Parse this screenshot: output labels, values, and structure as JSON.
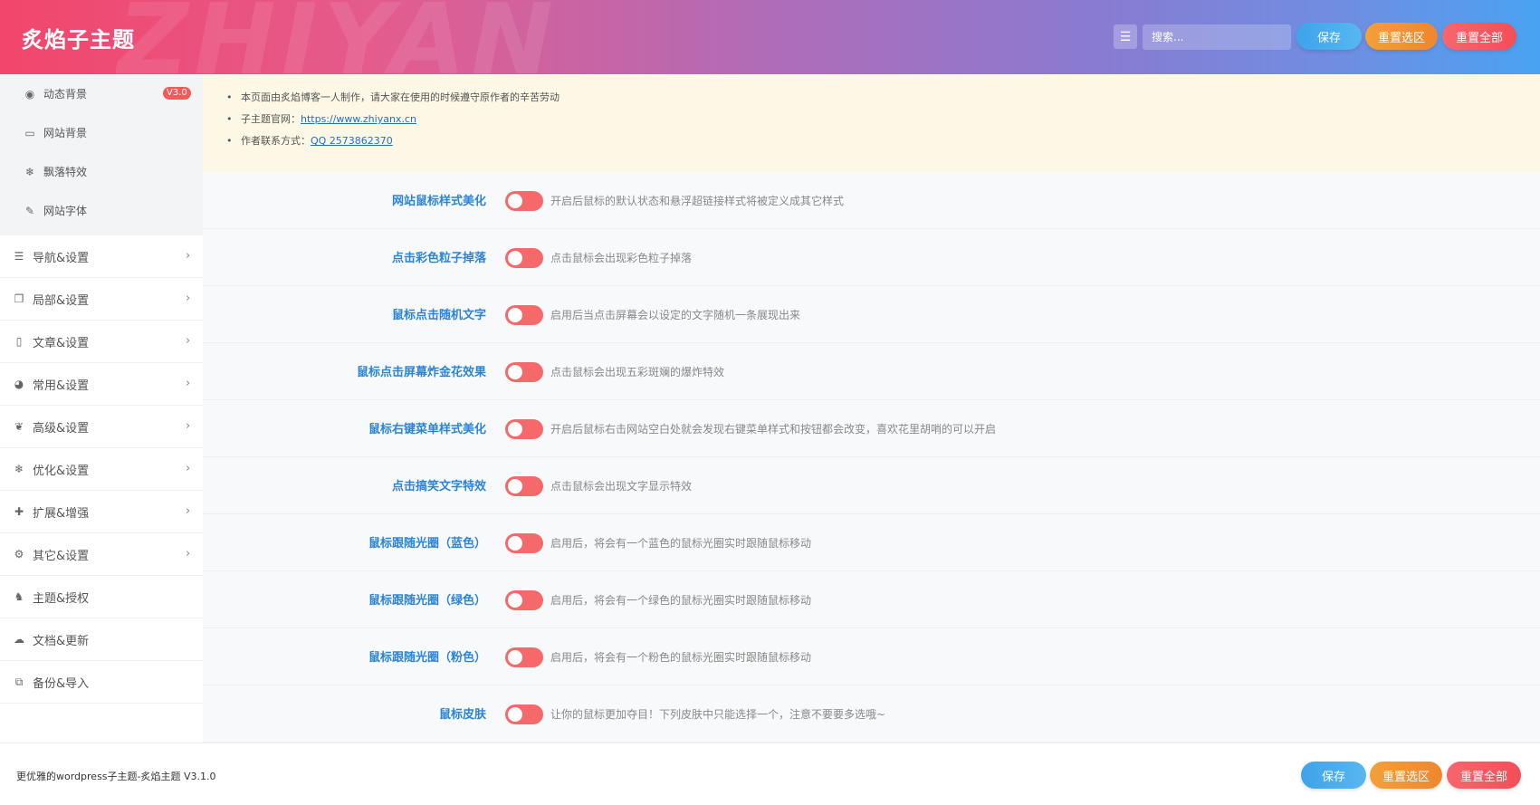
{
  "header": {
    "brand": "炙焰子主题",
    "watermark": "ZHIYAN",
    "search_placeholder": "搜索...",
    "save_label": "保存",
    "reset_section_label": "重置选区",
    "reset_all_label": "重置全部"
  },
  "sidebar": {
    "submenu": [
      {
        "label": "动态背景",
        "icon": "dashboard-icon",
        "badge": "V3.0"
      },
      {
        "label": "网站背景",
        "icon": "monitor-icon"
      },
      {
        "label": "飘落特效",
        "icon": "snowflake-icon"
      },
      {
        "label": "网站字体",
        "icon": "pencil-icon"
      }
    ],
    "items": [
      {
        "label": "导航&设置",
        "icon": "list-icon"
      },
      {
        "label": "局部&设置",
        "icon": "copy-icon"
      },
      {
        "label": "文章&设置",
        "icon": "map-icon"
      },
      {
        "label": "常用&设置",
        "icon": "pie-chart-icon"
      },
      {
        "label": "高级&设置",
        "icon": "leaf-icon"
      },
      {
        "label": "优化&设置",
        "icon": "snowflake-icon"
      },
      {
        "label": "扩展&增强",
        "icon": "puzzle-icon"
      },
      {
        "label": "其它&设置",
        "icon": "gear-icon"
      },
      {
        "label": "主题&授权",
        "icon": "gitlab-icon"
      },
      {
        "label": "文档&更新",
        "icon": "cloud-icon"
      },
      {
        "label": "备份&导入",
        "icon": "clone-icon"
      }
    ]
  },
  "notice": {
    "line1": "本页面由炙焰博客一人制作，请大家在使用的时候遵守原作者的辛苦劳动",
    "line2_prefix": "子主题官网：",
    "line2_link": "https://www.zhiyanx.cn",
    "line3_prefix": "作者联系方式：",
    "line3_link": "QQ 2573862370"
  },
  "settings": [
    {
      "label": "网站鼠标样式美化",
      "desc": "开启后鼠标的默认状态和悬浮超链接样式将被定义成其它样式"
    },
    {
      "label": "点击彩色粒子掉落",
      "desc": "点击鼠标会出现彩色粒子掉落"
    },
    {
      "label": "鼠标点击随机文字",
      "desc": "启用后当点击屏幕会以设定的文字随机一条展现出来"
    },
    {
      "label": "鼠标点击屏幕炸金花效果",
      "desc": "点击鼠标会出现五彩斑斓的爆炸特效"
    },
    {
      "label": "鼠标右键菜单样式美化",
      "desc": "开启后鼠标右击网站空白处就会发现右键菜单样式和按钮都会改变，喜欢花里胡哨的可以开启"
    },
    {
      "label": "点击搞笑文字特效",
      "desc": "点击鼠标会出现文字显示特效"
    },
    {
      "label": "鼠标跟随光圈（蓝色）",
      "desc": "启用后，将会有一个蓝色的鼠标光圈实时跟随鼠标移动"
    },
    {
      "label": "鼠标跟随光圈（绿色）",
      "desc": "启用后，将会有一个绿色的鼠标光圈实时跟随鼠标移动"
    },
    {
      "label": "鼠标跟随光圈（粉色）",
      "desc": "启用后，将会有一个粉色的鼠标光圈实时跟随鼠标移动"
    },
    {
      "label": "鼠标皮肤",
      "desc": "让你的鼠标更加夺目！下列皮肤中只能选择一个，注意不要要多选哦~"
    }
  ],
  "footer": {
    "version_text": "更优雅的wordpress子主题-炙焰主题 V3.1.0",
    "save_label": "保存",
    "reset_section_label": "重置选区",
    "reset_all_label": "重置全部"
  },
  "colors": {
    "accent_blue": "#2b84d8",
    "toggle_red": "#f5696a",
    "save": "#3fa3ec",
    "reset_section": "#f3a03a",
    "reset_all": "#f44d58"
  }
}
